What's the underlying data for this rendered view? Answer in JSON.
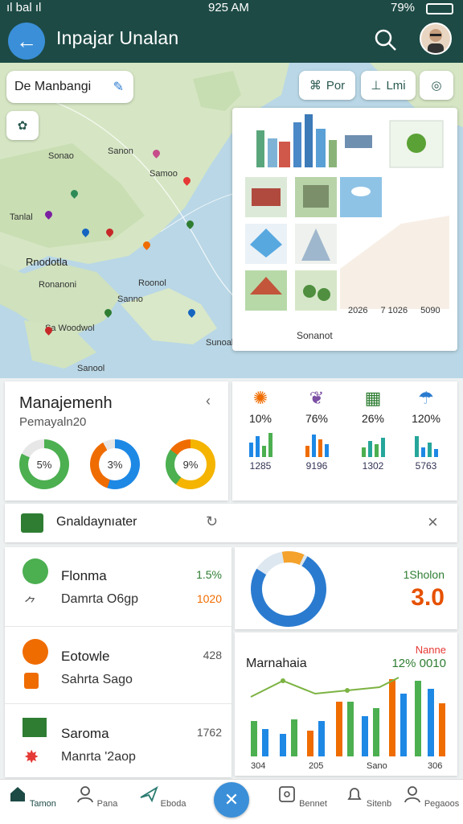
{
  "status_bar": {
    "left": "ıl bal ıl",
    "time": "925 AM",
    "right": "79%"
  },
  "header": {
    "title": "Inpajar Unalan"
  },
  "map": {
    "search_text": "De Manbangi",
    "poi_button": "Por",
    "filter_button": "Lmi",
    "labels": [
      "Sonao",
      "Sanon",
      "Samoo",
      "Tanlal",
      "Rnodotla",
      "Ronanoni",
      "Roonol",
      "Sa Woodwol",
      "Sanool",
      "Sanno",
      "Sunoal"
    ],
    "overlay_values": [
      "2026",
      "7 1026",
      "5090",
      "Sonanot"
    ]
  },
  "management": {
    "title": "Manajemenh",
    "subtitle": "Pemayaln20",
    "donuts": [
      "5%",
      "3%",
      "9%"
    ],
    "colors": {
      "green": "#4caf50",
      "blue": "#1e88e5",
      "orange": "#ef6c00",
      "yellow": "#f4b400",
      "red": "#e53935",
      "teal": "#26a69a"
    }
  },
  "stats": [
    {
      "pct": "10%",
      "val": "1285"
    },
    {
      "pct": "76%",
      "val": "9196"
    },
    {
      "pct": "26%",
      "val": "1302"
    },
    {
      "pct": "120%",
      "val": "5763"
    }
  ],
  "group_bar": {
    "label": "Gnaldaynıater"
  },
  "list": [
    {
      "label": "Flonma",
      "sub": "Damrta O6gp",
      "val1": "1.5%",
      "val2": "1020"
    },
    {
      "label": "Eotowle",
      "sub": "Sahrta Sago",
      "val1": "428",
      "val2": ""
    },
    {
      "label": "Saroma",
      "sub": "Manrta '2aop",
      "val1": "1762",
      "val2": ""
    }
  ],
  "summary": {
    "label": "1Sholon",
    "value": "3.0"
  },
  "combo": {
    "title": "Marnahaia",
    "top_label": "Nanne",
    "top_value": "12% 0010",
    "ticks": [
      "304",
      "205",
      "Sano",
      "306"
    ]
  },
  "nav": [
    "Tamon",
    "Pana",
    "Eboda",
    "Bennet",
    "Sitenb",
    "Pegaoos"
  ]
}
